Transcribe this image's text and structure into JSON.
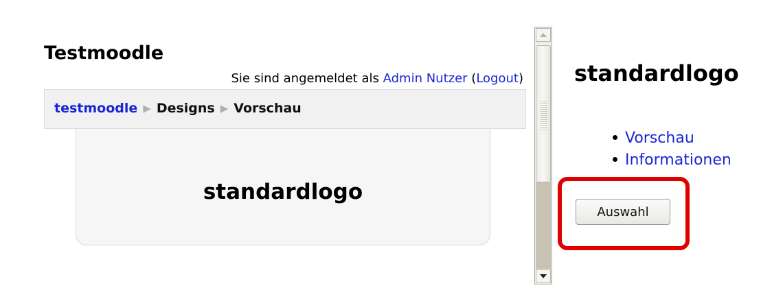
{
  "site": {
    "title": "Testmoodle",
    "login_prefix": "Sie sind angemeldet als",
    "user_name": "Admin Nutzer",
    "paren_open": "(",
    "logout_label": "Logout",
    "paren_close": ")"
  },
  "breadcrumb": {
    "home": "testmoodle",
    "items": [
      "Designs",
      "Vorschau"
    ],
    "separator": "▶"
  },
  "preview": {
    "logo_text": "standardlogo"
  },
  "details": {
    "title": "standardlogo",
    "links": [
      "Vorschau",
      "Informationen"
    ],
    "select_button": "Auswahl"
  },
  "colors": {
    "link": "#1a26d4",
    "highlight": "#e00000"
  }
}
